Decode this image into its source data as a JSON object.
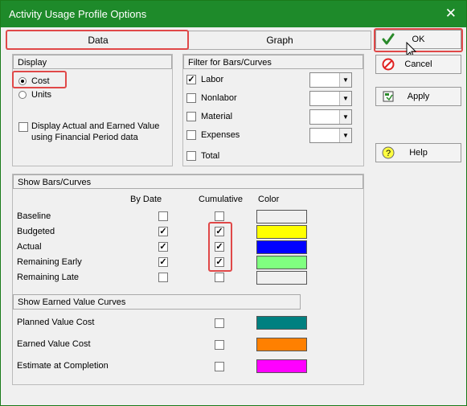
{
  "window": {
    "title": "Activity Usage Profile Options",
    "close_glyph": "✕"
  },
  "tabs": [
    {
      "label": "Data",
      "selected": true
    },
    {
      "label": "Graph",
      "selected": false
    }
  ],
  "display": {
    "title": "Display",
    "options": [
      {
        "label": "Cost",
        "selected": true
      },
      {
        "label": "Units",
        "selected": false
      }
    ],
    "financial_checkbox": {
      "checked": false,
      "label_line1": "Display Actual and Earned Value",
      "label_line2": "using Financial Period data"
    }
  },
  "filter": {
    "title": "Filter for Bars/Curves",
    "items": [
      {
        "label": "Labor",
        "checked": true
      },
      {
        "label": "Nonlabor",
        "checked": false
      },
      {
        "label": "Material",
        "checked": false
      },
      {
        "label": "Expenses",
        "checked": false
      }
    ],
    "total": {
      "label": "Total",
      "checked": false
    }
  },
  "show_bars": {
    "title": "Show Bars/Curves",
    "headers": {
      "by_date": "By Date",
      "cumulative": "Cumulative",
      "color": "Color"
    },
    "rows": [
      {
        "label": "Baseline",
        "by_date": false,
        "cumulative": false,
        "color": "#f0f0f0"
      },
      {
        "label": "Budgeted",
        "by_date": true,
        "cumulative": true,
        "color": "#ffff00"
      },
      {
        "label": "Actual",
        "by_date": true,
        "cumulative": true,
        "color": "#0000ff"
      },
      {
        "label": "Remaining Early",
        "by_date": true,
        "cumulative": true,
        "color": "#80ff80"
      },
      {
        "label": "Remaining Late",
        "by_date": false,
        "cumulative": false,
        "color": "#f0f0f0"
      }
    ]
  },
  "earned_value": {
    "title": "Show Earned Value Curves",
    "rows": [
      {
        "label": "Planned Value Cost",
        "checked": false,
        "color": "#008080"
      },
      {
        "label": "Earned Value Cost",
        "checked": false,
        "color": "#ff8000"
      },
      {
        "label": "Estimate at Completion",
        "checked": false,
        "color": "#ff00ff"
      }
    ]
  },
  "buttons": {
    "ok": "OK",
    "cancel": "Cancel",
    "apply": "Apply",
    "help": "Help"
  },
  "check_glyph": "✓"
}
